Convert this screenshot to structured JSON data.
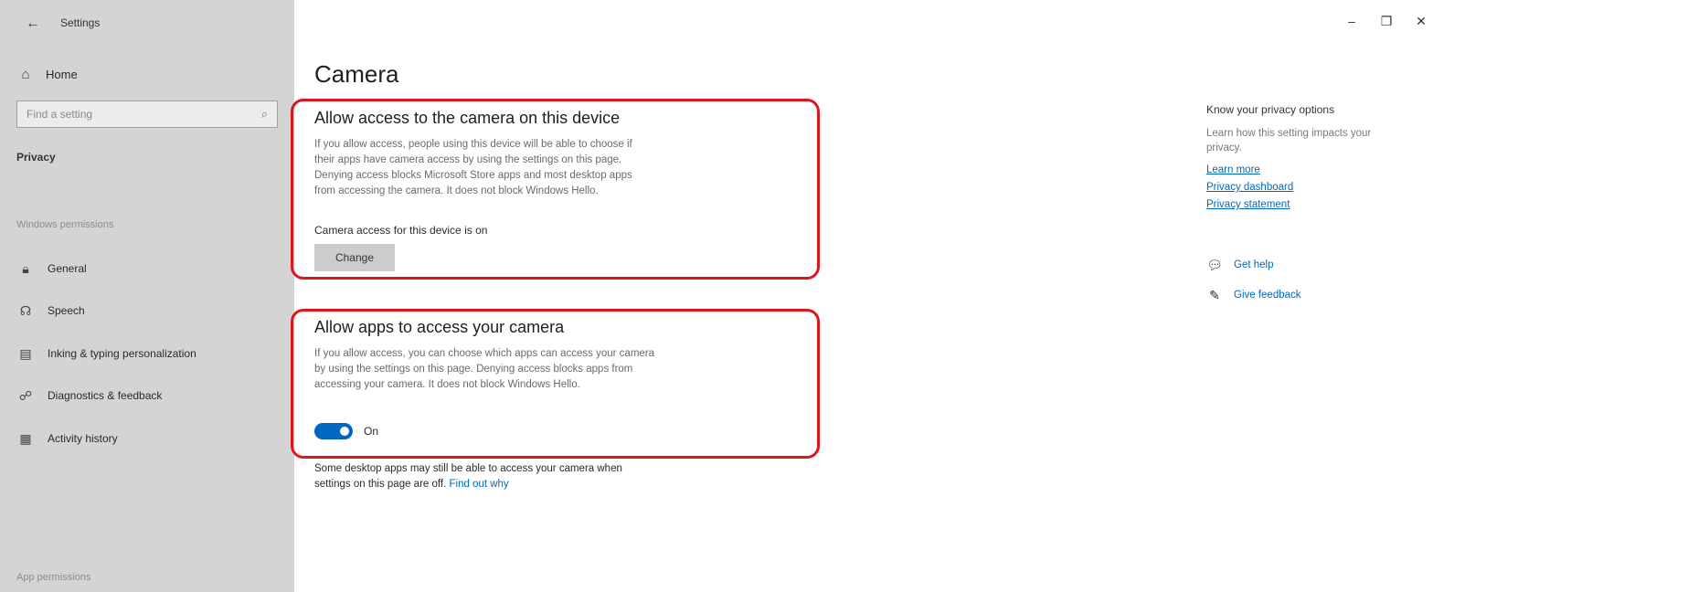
{
  "window": {
    "title": "Settings",
    "back_icon": "back-arrow-icon",
    "minimize": "–",
    "restore": "❐",
    "close": "✕"
  },
  "sidebar": {
    "home_label": "Home",
    "search_placeholder": "Find a setting",
    "section_label": "Privacy",
    "group_windows_permissions": "Windows permissions",
    "items": [
      {
        "label": "General",
        "icon": "lock-icon"
      },
      {
        "label": "Speech",
        "icon": "speech-icon"
      },
      {
        "label": "Inking & typing personalization",
        "icon": "inking-icon"
      },
      {
        "label": "Diagnostics & feedback",
        "icon": "diagnostics-icon"
      },
      {
        "label": "Activity history",
        "icon": "activity-icon"
      }
    ],
    "group_app_permissions": "App permissions"
  },
  "main": {
    "title": "Camera",
    "section1": {
      "title": "Allow access to the camera on this device",
      "description_lines": [
        "If you allow access, people using this device will be able to choose if",
        "their apps have camera access by using the settings on this page.",
        "Denying access blocks Microsoft Store apps and most desktop apps",
        "from accessing the camera. It does not block Windows Hello."
      ],
      "status": "Camera access for this device is on",
      "button_label": "Change"
    },
    "section2": {
      "title": "Allow apps to access your camera",
      "description_lines": [
        "If you allow access, you can choose which apps can access your camera",
        "by using the settings on this page. Denying access blocks apps from",
        "accessing your camera. It does not block Windows Hello."
      ],
      "toggle_state": "On",
      "toggle_on": true
    },
    "note_line1": "Some desktop apps may still be able to access your camera when",
    "note_line2": "settings on this page are off.",
    "note_link": "Find out why"
  },
  "right_panel": {
    "title": "Know your privacy options",
    "description_lines": [
      "Learn how this setting impacts your",
      "privacy."
    ],
    "links": [
      "Learn more",
      "Privacy dashboard",
      "Privacy statement"
    ],
    "get_help": "Get help",
    "give_feedback": "Give feedback"
  },
  "colors": {
    "sidebar_bg": "#d4d4d4",
    "accent": "#0067c0",
    "highlight_border": "#e0141b"
  }
}
